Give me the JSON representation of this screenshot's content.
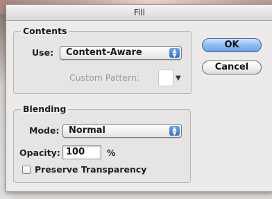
{
  "dialog": {
    "title": "Fill"
  },
  "contents": {
    "group_label": "Contents",
    "use_label": "Use:",
    "use_value": "Content-Aware",
    "custom_pattern_label": "Custom Pattern:"
  },
  "buttons": {
    "ok": "OK",
    "cancel": "Cancel"
  },
  "blending": {
    "group_label": "Blending",
    "mode_label": "Mode:",
    "mode_value": "Normal",
    "opacity_label": "Opacity:",
    "opacity_value": "100",
    "opacity_unit": "%",
    "preserve_label": "Preserve Transparency",
    "preserve_checked": false
  },
  "icons": {
    "popup_arrows": "updown-arrows-icon",
    "pattern_dropdown": "triangle-down-icon"
  },
  "colors": {
    "default_button": "#8fbcef",
    "popup_arrow": "#2f6fd0"
  }
}
